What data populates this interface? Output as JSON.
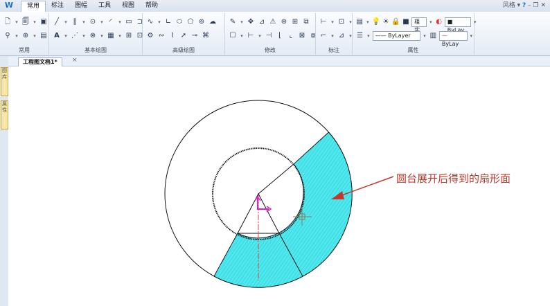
{
  "menu": {
    "tabs": [
      "常用",
      "标注",
      "图幅",
      "工具",
      "视图",
      "帮助"
    ],
    "style_label": "风格",
    "help_icon": "?"
  },
  "ribbon": {
    "groups": [
      "常用",
      "基本绘图",
      "高级绘图",
      "修改",
      "标注",
      "属性"
    ],
    "properties": {
      "fill_mode": "粗实",
      "color": "ByLay",
      "linetype": "ByLayer",
      "lineweight": "ByLay"
    }
  },
  "side_tabs": [
    "图库",
    "属性"
  ],
  "document": {
    "tab_title": "工程图文档1*",
    "close_icon": "×"
  },
  "annotation": {
    "text": "圆台展开后得到的扇形面"
  },
  "colors": {
    "sector_fill": "#4fe8ee",
    "annotation": "#c0392b",
    "axis_magenta": "#e020c0"
  }
}
